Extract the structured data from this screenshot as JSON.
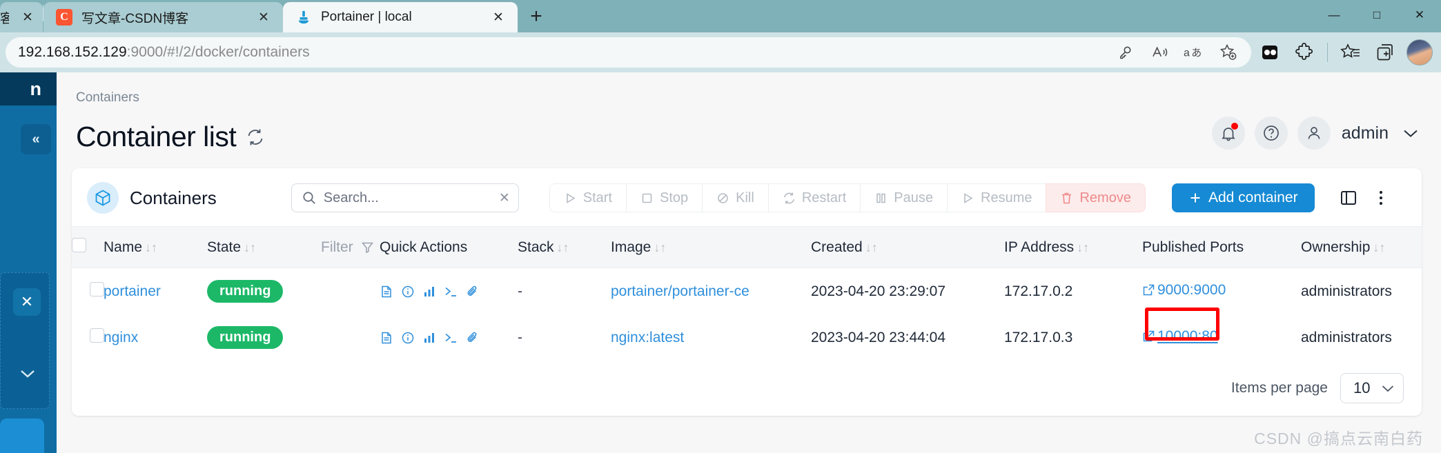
{
  "browser": {
    "tabs": [
      {
        "title": "客",
        "favicon": "",
        "active": false,
        "partial": true
      },
      {
        "title": "写文章-CSDN博客",
        "favicon": "C",
        "active": false,
        "partial": false
      },
      {
        "title": "Portainer | local",
        "favicon": "portainer-whale-icon",
        "active": true,
        "partial": false
      }
    ],
    "new_tab_label": "+",
    "window_controls": [
      "—",
      "□",
      "✕"
    ],
    "url": {
      "host": "192.168.152.129",
      "rest": ":9000/#!/2/docker/containers"
    },
    "url_icons": [
      "key-icon",
      "read-aloud-icon",
      "translate-icon",
      "add-favorite-icon"
    ],
    "toolbar_icons": [
      "split-screen-icon",
      "extensions-icon",
      "favorites-icon",
      "collections-icon",
      "profile-avatar"
    ]
  },
  "sidebar": {
    "header_text": "n",
    "collapse_label": "«",
    "close_label": "✕",
    "chevron_label": "⌄"
  },
  "header": {
    "breadcrumb": "Containers",
    "title": "Container list",
    "refresh_icon": "refresh-icon",
    "user": {
      "notifications_icon": "bell-icon",
      "help_icon": "help-circle-icon",
      "avatar_icon": "user-icon",
      "name": "admin",
      "chevron": "⌄"
    }
  },
  "card": {
    "icon": "cube-icon",
    "title": "Containers",
    "search": {
      "placeholder": "Search...",
      "value": "",
      "icon": "search-icon",
      "clear_icon": "close-icon"
    },
    "actions": [
      {
        "label": "Start",
        "icon": "play-icon",
        "state": "disabled"
      },
      {
        "label": "Stop",
        "icon": "square-icon",
        "state": "disabled"
      },
      {
        "label": "Kill",
        "icon": "ban-icon",
        "state": "disabled"
      },
      {
        "label": "Restart",
        "icon": "refresh-icon",
        "state": "disabled"
      },
      {
        "label": "Pause",
        "icon": "pause-icon",
        "state": "disabled"
      },
      {
        "label": "Resume",
        "icon": "play-icon",
        "state": "disabled"
      },
      {
        "label": "Remove",
        "icon": "trash-icon",
        "state": "danger"
      }
    ],
    "add_button": {
      "label": "Add container",
      "icon": "plus-icon",
      "color": "#168ad4"
    },
    "columns_icon": "columns-layout-icon",
    "menu_icon": "kebab-menu-icon"
  },
  "table": {
    "columns": [
      {
        "label": "",
        "sortable": false,
        "key": "check"
      },
      {
        "label": "Name",
        "sortable": true,
        "key": "name"
      },
      {
        "label": "State",
        "sortable": true,
        "key": "state"
      },
      {
        "label": "Filter",
        "sortable": false,
        "key": "filter",
        "icon": "funnel-icon"
      },
      {
        "label": "Quick Actions",
        "sortable": false,
        "key": "quick_actions"
      },
      {
        "label": "Stack",
        "sortable": true,
        "key": "stack"
      },
      {
        "label": "Image",
        "sortable": true,
        "key": "image"
      },
      {
        "label": "Created",
        "sortable": true,
        "key": "created"
      },
      {
        "label": "IP Address",
        "sortable": true,
        "key": "ip"
      },
      {
        "label": "Published Ports",
        "sortable": false,
        "key": "ports"
      },
      {
        "label": "Ownership",
        "sortable": true,
        "key": "ownership"
      }
    ],
    "sort_glyph": "↓↑",
    "quick_action_icons": [
      "logs-icon",
      "inspect-info-icon",
      "stats-chart-icon",
      "console-icon",
      "attach-icon"
    ],
    "rows": [
      {
        "checked": false,
        "name": "portainer",
        "state": "running",
        "stack": "-",
        "image": "portainer/portainer-ce",
        "created": "2023-04-20 23:29:07",
        "ip": "172.17.0.2",
        "ports": "9000:9000",
        "ports_icon": "external-link-icon",
        "ports_highlighted": false,
        "ownership": "administrators"
      },
      {
        "checked": false,
        "name": "nginx",
        "state": "running",
        "stack": "-",
        "image": "nginx:latest",
        "created": "2023-04-20 23:44:04",
        "ip": "172.17.0.3",
        "ports": "10000:80",
        "ports_icon": "external-link-icon",
        "ports_highlighted": true,
        "ownership": "administrators"
      }
    ]
  },
  "footer": {
    "items_per_page_label": "Items per page",
    "items_per_page_value": "10",
    "chevron": "⌄"
  },
  "watermark": "CSDN @搞点云南白药",
  "colors": {
    "accent": "#168ad4",
    "link": "#2f8fdc",
    "running": "#1cb868",
    "danger": "#ef8a8a",
    "annotation": "#ff0000"
  }
}
